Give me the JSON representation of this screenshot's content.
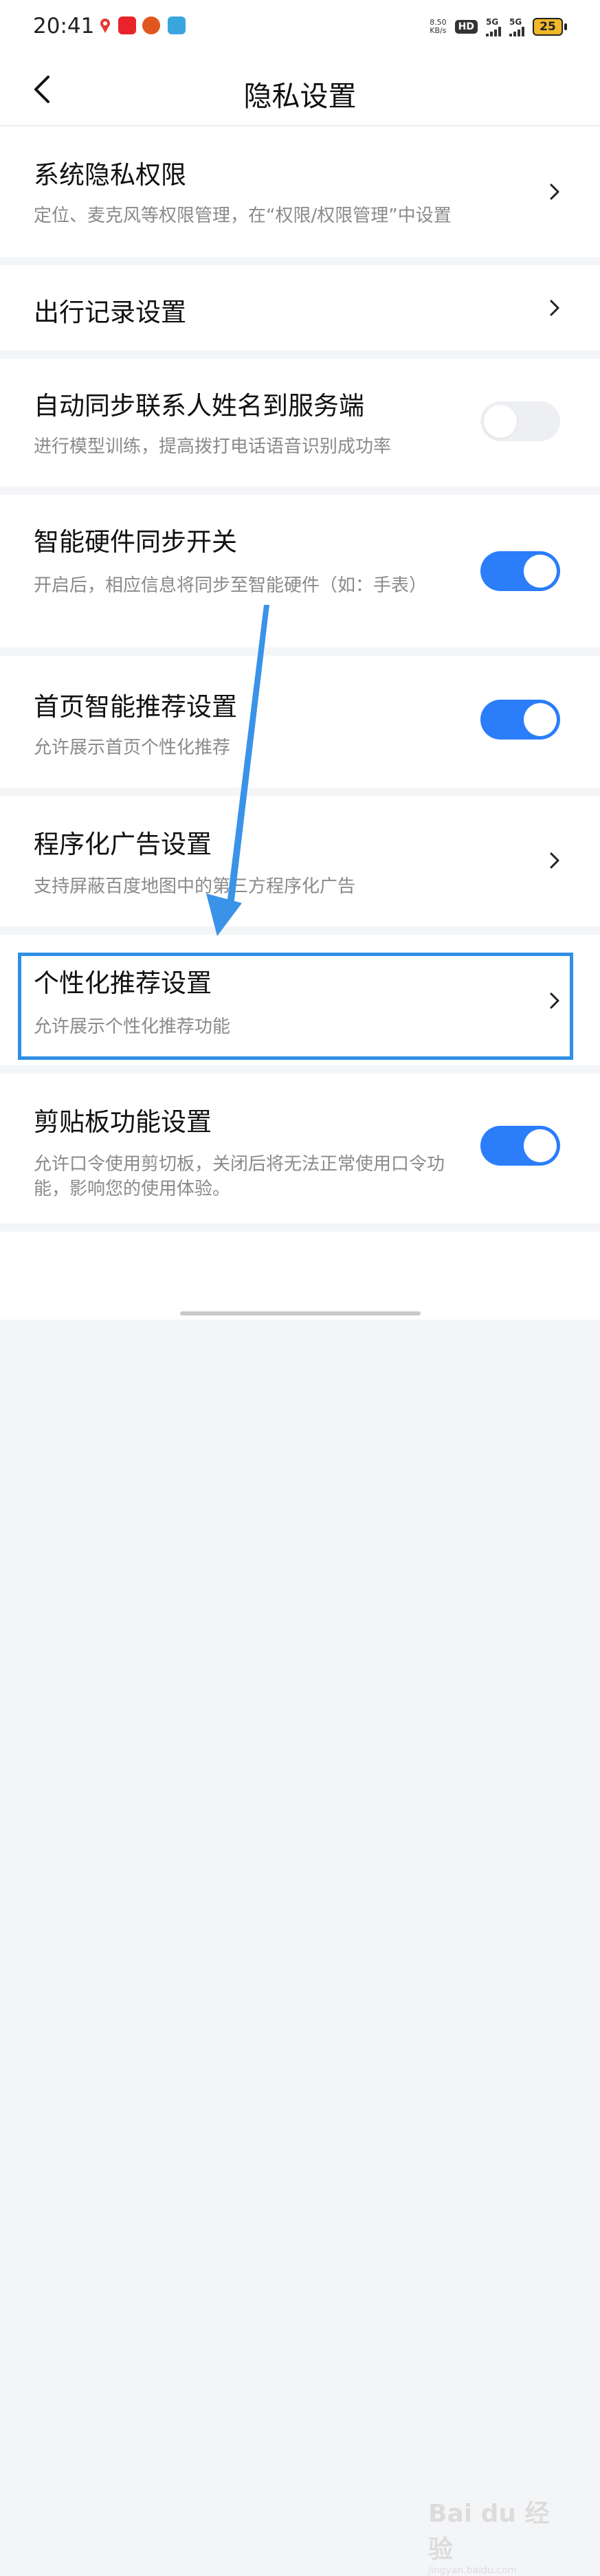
{
  "status_bar": {
    "time": "20:41",
    "net_speed_value": "8.50",
    "net_speed_unit": "KB/s",
    "hd_label": "HD",
    "sim1_label": "5G",
    "sim2_label": "5G",
    "battery_level": "25",
    "notification_icons": [
      "map-pin-icon",
      "app-badge-icon",
      "pumpkin-icon",
      "chat-icon"
    ]
  },
  "header": {
    "title": "隐私设置",
    "back_icon": "chevron-left-icon"
  },
  "settings": [
    {
      "id": "system-privacy",
      "title": "系统隐私权限",
      "desc": "定位、麦克风等权限管理，在“权限/权限管理”中设置",
      "control": "chevron"
    },
    {
      "id": "travel-record",
      "title": "出行记录设置",
      "desc": "",
      "control": "chevron"
    },
    {
      "id": "contact-sync",
      "title": "自动同步联系人姓名到服务端",
      "desc": "进行模型训练，提高拨打电话语音识别成功率",
      "control": "toggle",
      "enabled": false
    },
    {
      "id": "hardware-sync",
      "title": "智能硬件同步开关",
      "desc": "开启后，相应信息将同步至智能硬件（如：手表）",
      "control": "toggle",
      "enabled": true
    },
    {
      "id": "home-recommend",
      "title": "首页智能推荐设置",
      "desc": "允许展示首页个性化推荐",
      "control": "toggle",
      "enabled": true
    },
    {
      "id": "programmatic-ads",
      "title": "程序化广告设置",
      "desc": "支持屏蔽百度地图中的第三方程序化广告",
      "control": "chevron"
    },
    {
      "id": "personalized-recommend",
      "title": "个性化推荐设置",
      "desc": "允许展示个性化推荐功能",
      "control": "chevron"
    },
    {
      "id": "clipboard",
      "title": "剪贴板功能设置",
      "desc": "允许口令使用剪切板，关闭后将无法正常使用口令功能，影响您的使用体验。",
      "control": "toggle",
      "enabled": true
    }
  ],
  "colors": {
    "accent": "#2b7dfa",
    "highlight": "#2e8fe6",
    "background": "#f4f5f7"
  },
  "watermark": {
    "text": "Bai du 经验",
    "sub": "jingyan.baidu.com"
  }
}
